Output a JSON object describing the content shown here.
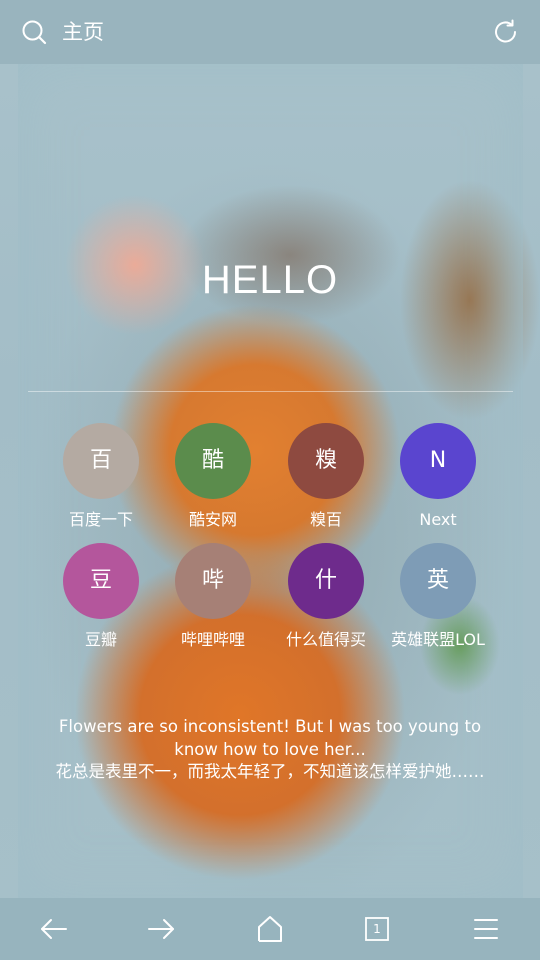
{
  "topbar": {
    "title": "主页",
    "search_icon": "search-icon",
    "refresh_icon": "refresh-icon"
  },
  "hello": "HELLO",
  "shortcuts": [
    {
      "glyph": "百",
      "label": "百度一下",
      "color": "#b4aaa2"
    },
    {
      "glyph": "酷",
      "label": "酷安网",
      "color": "#5b8c4c"
    },
    {
      "glyph": "糗",
      "label": "糗百",
      "color": "#8e4a40"
    },
    {
      "glyph": "N",
      "label": "Next",
      "color": "#5a45cf"
    },
    {
      "glyph": "豆",
      "label": "豆瓣",
      "color": "#b4569c"
    },
    {
      "glyph": "哔",
      "label": "哔哩哔哩",
      "color": "#a68076"
    },
    {
      "glyph": "什",
      "label": "什么值得买",
      "color": "#6e2b8c"
    },
    {
      "glyph": "英",
      "label": "英雄联盟LOL",
      "color": "#7e9cb6"
    }
  ],
  "quote": {
    "en": "Flowers are so inconsistent! But I was too young to know how to love her...",
    "zh": "花总是表里不一，而我太年轻了，不知道该怎样爱护她……"
  },
  "bottombar": {
    "back_icon": "arrow-left-icon",
    "forward_icon": "arrow-right-icon",
    "home_icon": "home-icon",
    "tabs_count": "1",
    "menu_icon": "menu-icon"
  }
}
